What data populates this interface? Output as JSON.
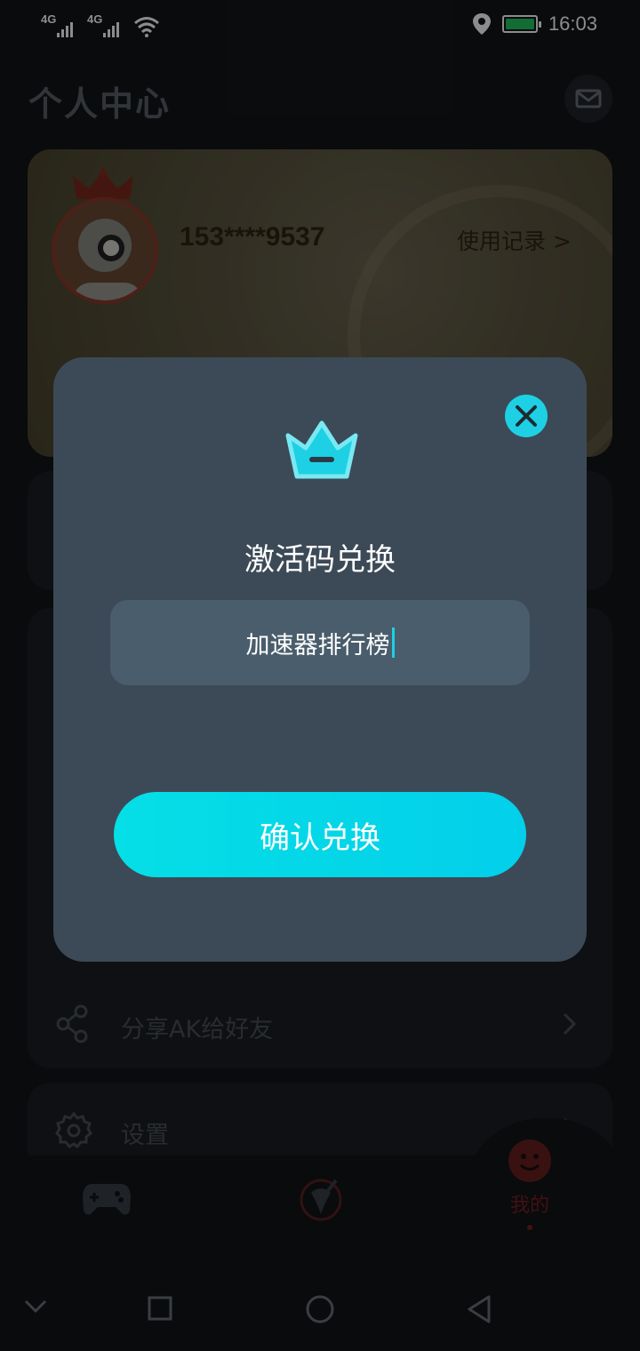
{
  "status_bar": {
    "network_1": "4G",
    "network_2": "4G",
    "time": "16:03",
    "icons": [
      "signal-icon",
      "signal-icon",
      "wifi-icon",
      "location-icon",
      "battery-icon"
    ],
    "battery_color": "#22c55e"
  },
  "header": {
    "title": "个人中心",
    "mail_icon": "mail-icon"
  },
  "profile": {
    "phone": "153****9537",
    "usage_link": "使用记录 >"
  },
  "menu": {
    "items": [
      {
        "label": "分享AK给好友",
        "icon": "share-icon"
      },
      {
        "label": "设置",
        "icon": "settings-icon"
      }
    ]
  },
  "bottom_nav": {
    "items": [
      {
        "label": "",
        "icon": "gamepad-icon"
      },
      {
        "label": "",
        "icon": "speedometer-icon"
      },
      {
        "label": "我的",
        "icon": "smiley-icon",
        "active": true
      }
    ]
  },
  "dialog": {
    "title": "激活码兑换",
    "input_value": "加速器排行榜",
    "confirm_label": "确认兑换",
    "close_icon": "close-icon",
    "header_icon": "crown-icon",
    "accent_color": "#1ed0e3"
  },
  "system_nav": {
    "icons": [
      "chevron-down-icon",
      "recents-icon",
      "home-icon",
      "back-icon"
    ]
  }
}
